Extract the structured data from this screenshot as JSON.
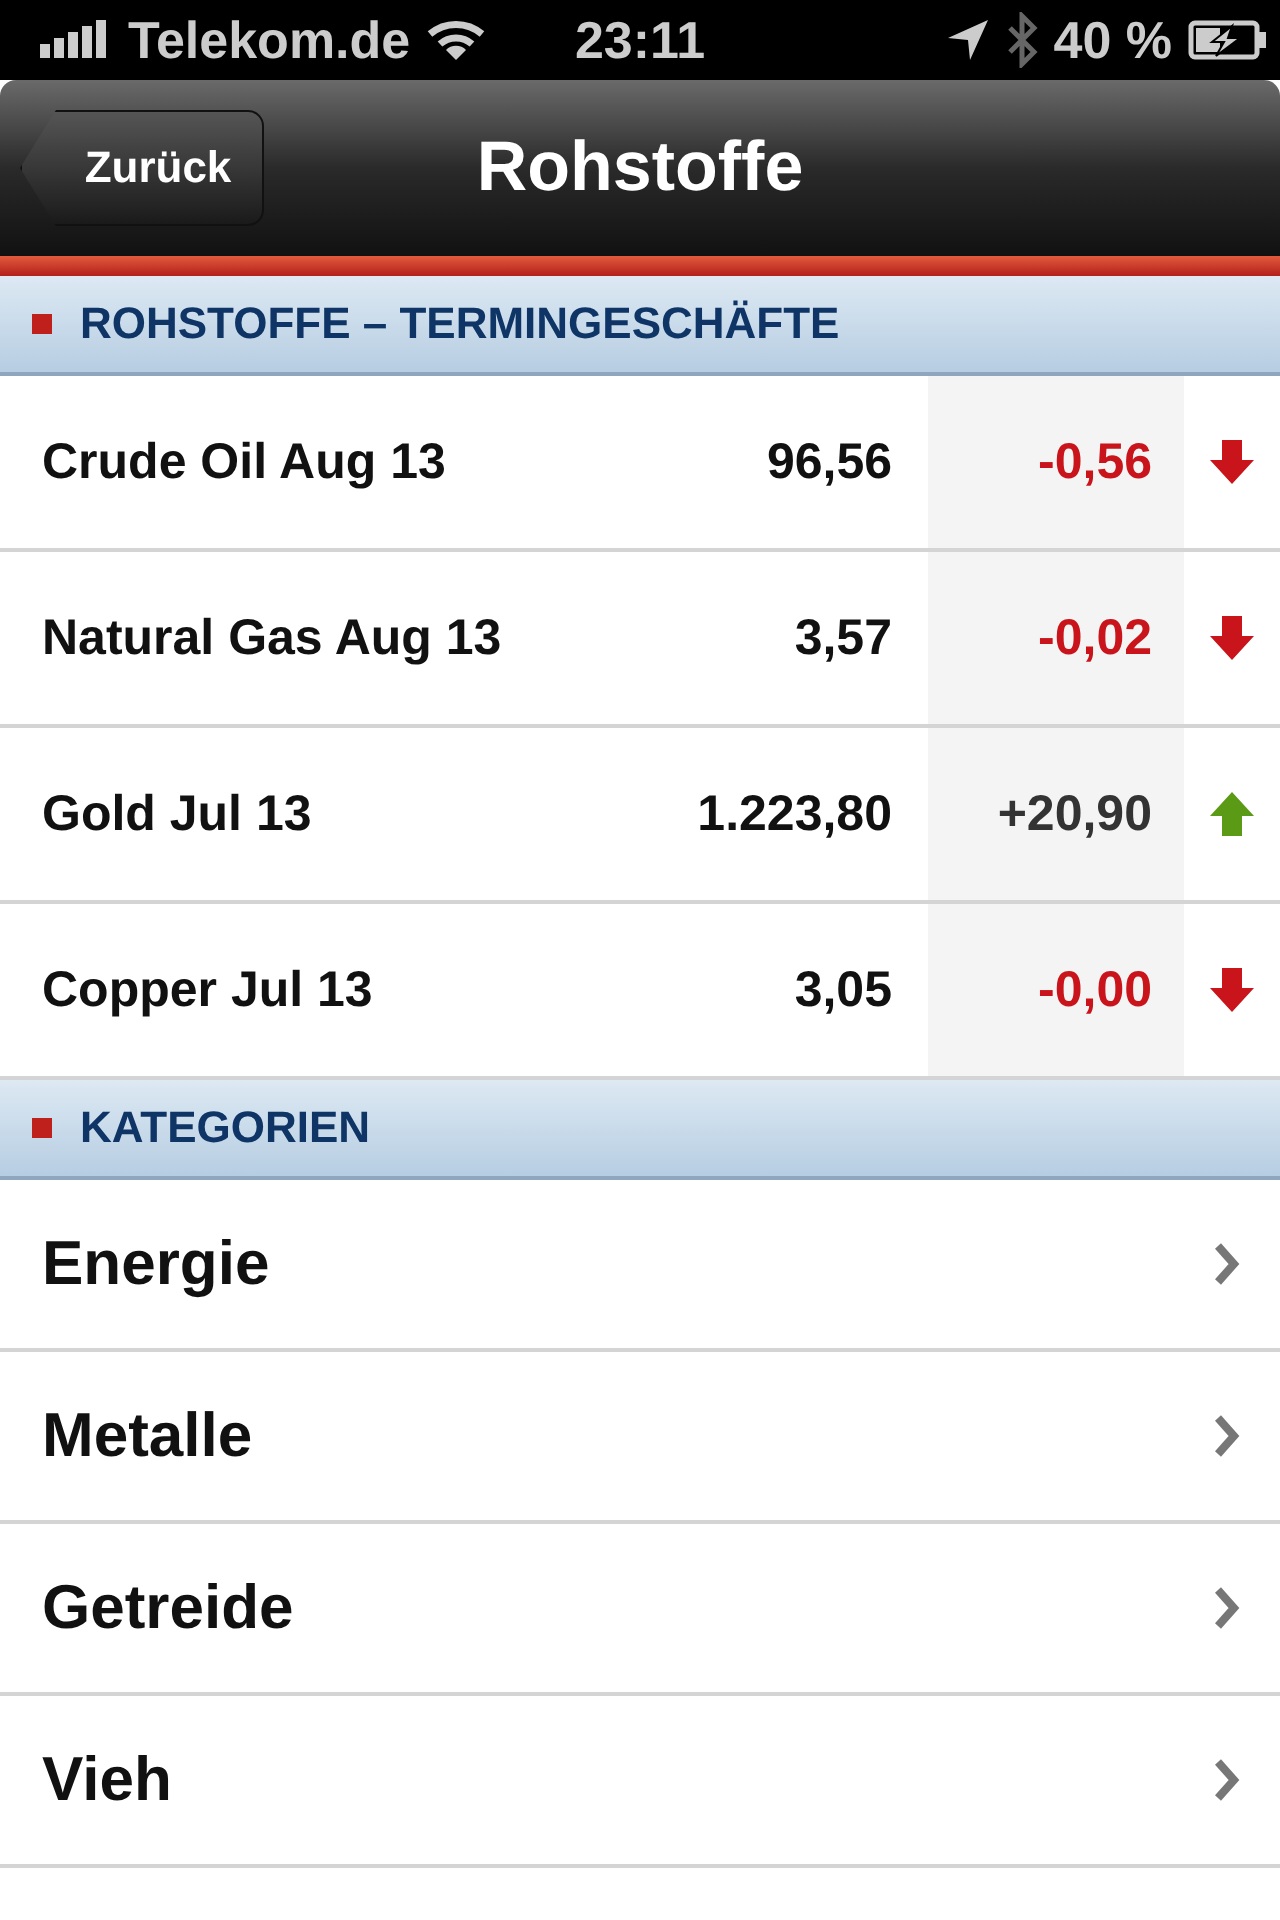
{
  "status_bar": {
    "carrier": "Telekom.de",
    "time": "23:11",
    "battery": "40 %"
  },
  "nav": {
    "back": "Zurück",
    "title": "Rohstoffe"
  },
  "sections": [
    {
      "title": "ROHSTOFFE – TERMINGESCHÄFTE",
      "kind": "quotes",
      "rows": [
        {
          "name": "Crude Oil Aug 13",
          "price": "96,56",
          "change": "-0,56",
          "up": false
        },
        {
          "name": "Natural Gas Aug 13",
          "price": "3,57",
          "change": "-0,02",
          "up": false
        },
        {
          "name": "Gold Jul 13",
          "price": "1.223,80",
          "change": "+20,90",
          "up": true
        },
        {
          "name": "Copper Jul 13",
          "price": "3,05",
          "change": "-0,00",
          "up": false
        }
      ]
    },
    {
      "title": "KATEGORIEN",
      "kind": "links",
      "rows": [
        {
          "name": "Energie"
        },
        {
          "name": "Metalle"
        },
        {
          "name": "Getreide"
        },
        {
          "name": "Vieh"
        }
      ]
    }
  ]
}
